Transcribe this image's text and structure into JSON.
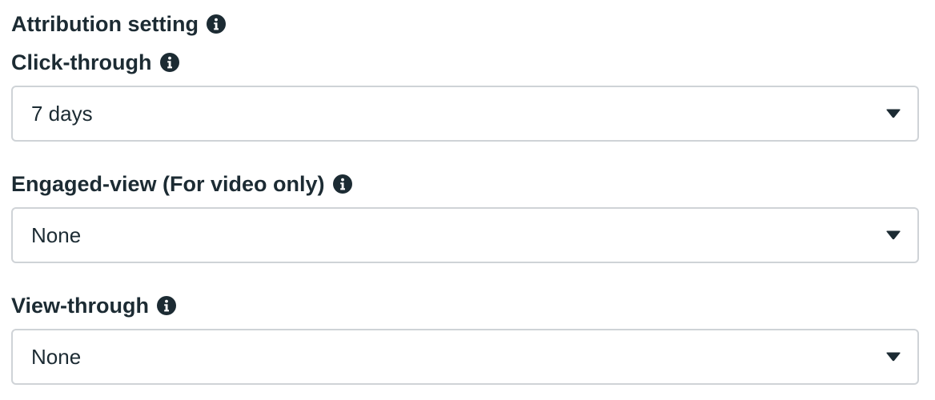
{
  "section": {
    "title": "Attribution setting",
    "title_icon": "info-icon"
  },
  "fields": [
    {
      "label": "Click-through",
      "label_icon": "info-icon",
      "value": "7 days",
      "control_icon": "caret-down-icon"
    },
    {
      "label": "Engaged-view (For video only)",
      "label_icon": "info-icon",
      "value": "None",
      "control_icon": "caret-down-icon"
    },
    {
      "label": "View-through",
      "label_icon": "info-icon",
      "value": "None",
      "control_icon": "caret-down-icon"
    }
  ],
  "colors": {
    "text": "#1c2b33",
    "border": "#cfd3d7",
    "background": "#ffffff"
  }
}
